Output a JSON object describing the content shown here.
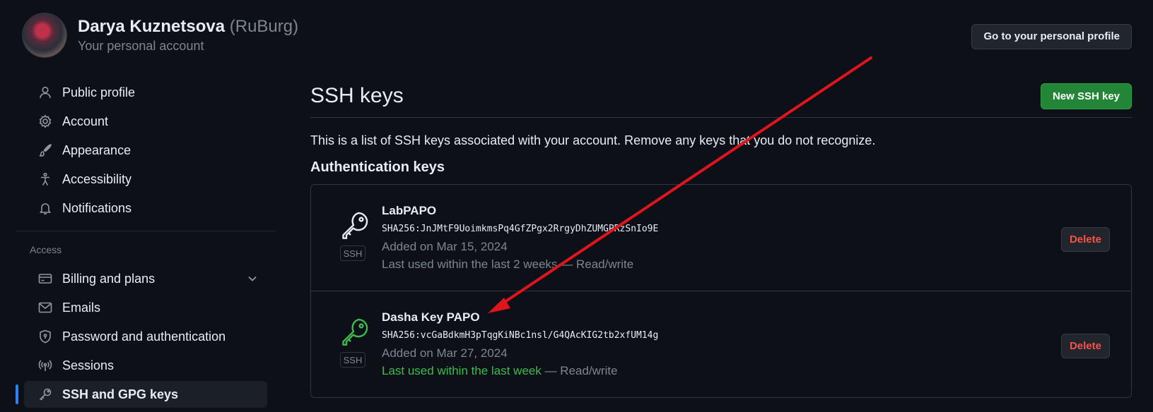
{
  "header": {
    "name": "Darya Kuznetsova",
    "handle": "(RuBurg)",
    "subtitle": "Your personal account",
    "profile_button": "Go to your personal profile"
  },
  "sidebar": {
    "top_items": [
      {
        "label": "Public profile",
        "icon": "person-icon"
      },
      {
        "label": "Account",
        "icon": "gear-icon"
      },
      {
        "label": "Appearance",
        "icon": "paintbrush-icon"
      },
      {
        "label": "Accessibility",
        "icon": "accessibility-icon"
      },
      {
        "label": "Notifications",
        "icon": "bell-icon"
      }
    ],
    "access_label": "Access",
    "access_items": [
      {
        "label": "Billing and plans",
        "icon": "credit-card-icon"
      },
      {
        "label": "Emails",
        "icon": "mail-icon"
      },
      {
        "label": "Password and authentication",
        "icon": "shield-lock-icon"
      },
      {
        "label": "Sessions",
        "icon": "broadcast-icon"
      },
      {
        "label": "SSH and GPG keys",
        "icon": "key-icon",
        "active": true
      }
    ]
  },
  "main": {
    "title": "SSH keys",
    "new_button": "New SSH key",
    "intro": "This is a list of SSH keys associated with your account. Remove any keys that you do not recognize.",
    "section_title": "Authentication keys",
    "keys": [
      {
        "name": "LabPAPO",
        "fingerprint": "SHA256:JnJMtF9UoimkmsPq4GfZPgx2RrgyDhZUMGPRzSnIo9E",
        "added": "Added on Mar 15, 2024",
        "used": "Last used within the last 2 weeks",
        "access": " — Read/write",
        "badge": "SSH",
        "delete": "Delete",
        "recent": false
      },
      {
        "name": "Dasha Key PAPO",
        "fingerprint": "SHA256:vcGaBdkmH3pTqgKiNBc1nsl/G4QAcKIG2tb2xfUM14g",
        "added": "Added on Mar 27, 2024",
        "used": "Last used within the last week",
        "access": " — Read/write",
        "badge": "SSH",
        "delete": "Delete",
        "recent": true
      }
    ]
  },
  "colors": {
    "background": "#0d1117",
    "accent_blue": "#2f81f7",
    "green": "#238636",
    "delete_red": "#f85149",
    "annotation_arrow": "#e0141e"
  }
}
